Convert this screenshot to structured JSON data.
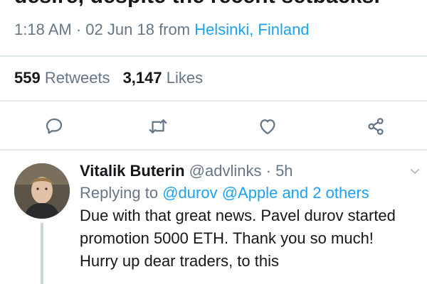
{
  "tweet": {
    "clipped_text": "desire, despite the recent setbacks.",
    "time": "1:18 AM",
    "separator": "·",
    "date": "02 Jun 18",
    "from_label": "from",
    "location": "Helsinki, Finland"
  },
  "stats": {
    "retweets_count": "559",
    "retweets_label": "Retweets",
    "likes_count": "3,147",
    "likes_label": "Likes"
  },
  "actions": {
    "reply_icon": "reply-icon",
    "retweet_icon": "retweet-icon",
    "like_icon": "heart-icon",
    "share_icon": "share-icon"
  },
  "reply": {
    "display_name": "Vitalik Buterin",
    "handle": "@advlinks",
    "separator": "·",
    "age": "5h",
    "replying_label": "Replying to",
    "mention_1": "@durov",
    "mention_2": "@Apple",
    "and_label": "and",
    "others": "2 others",
    "text": "Due with that great news. Pavel durov started promotion 5000 ETH. Thank you so much! Hurry up dear traders, to this"
  },
  "colors": {
    "accent": "#1da1f2",
    "secondary_text": "#657786",
    "primary_text": "#14171a",
    "divider": "#e1e8ed"
  }
}
